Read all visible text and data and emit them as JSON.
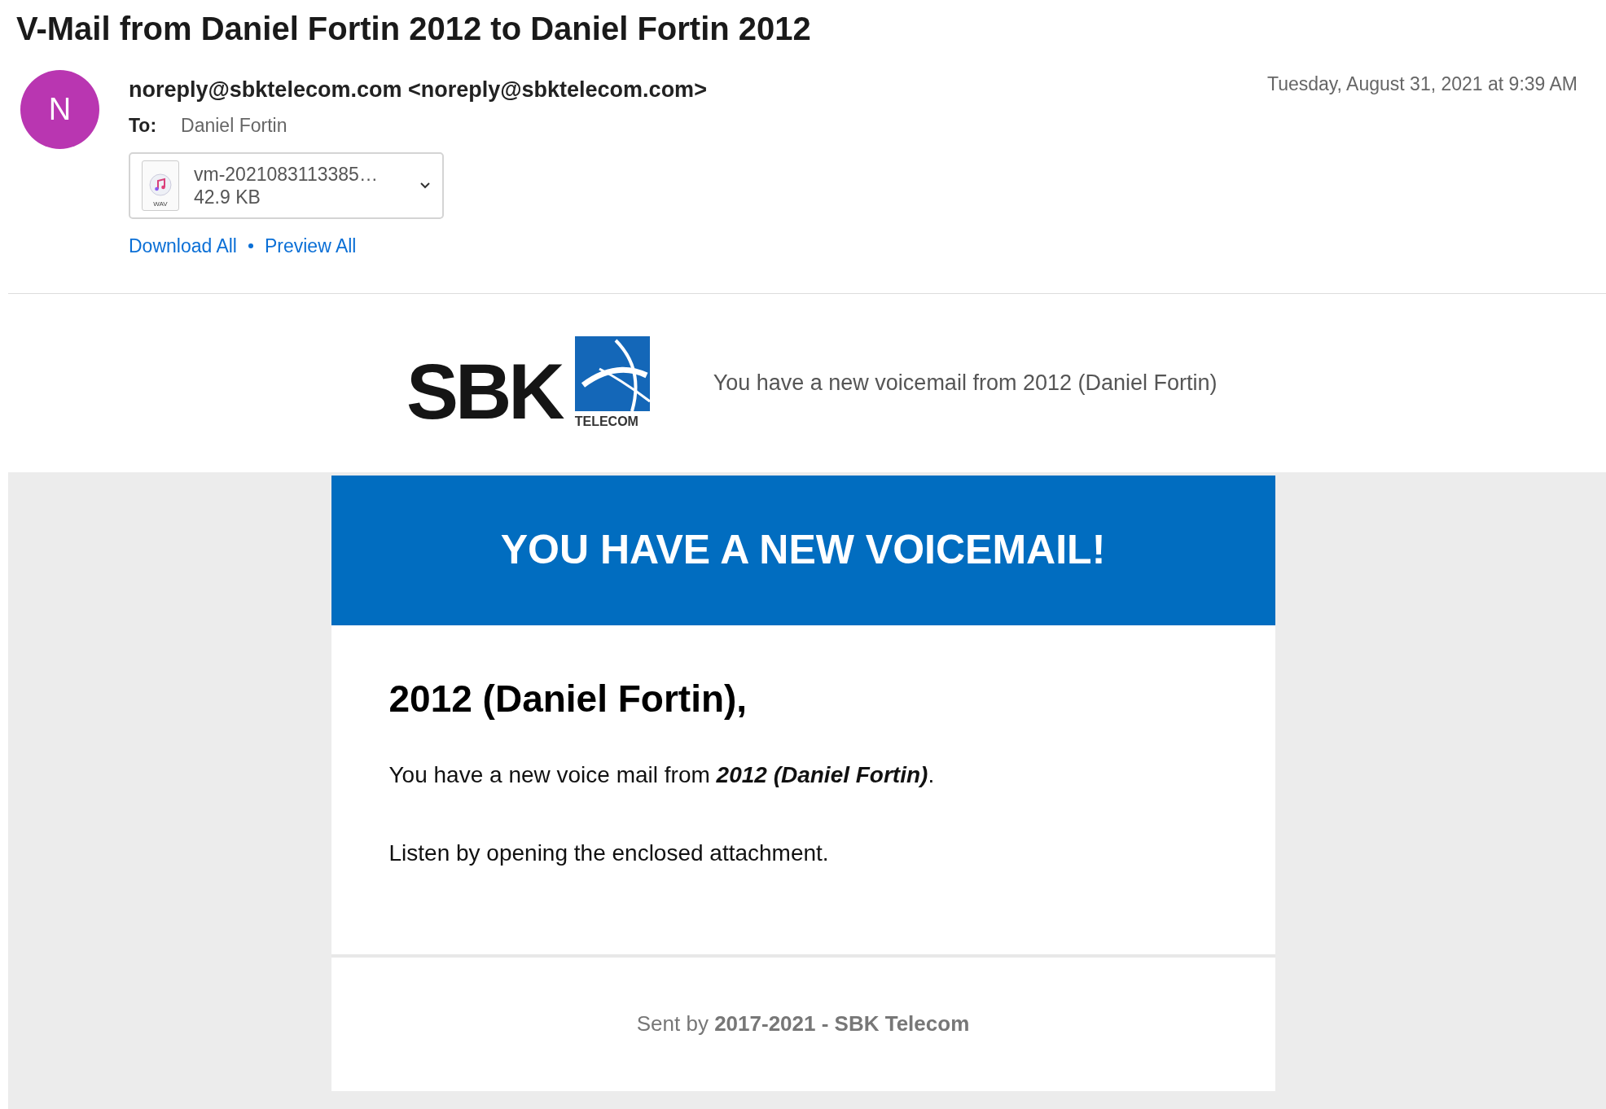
{
  "subject": "V-Mail from Daniel Fortin 2012 to Daniel Fortin 2012",
  "sender": {
    "avatar_letter": "N",
    "from": "noreply@sbktelecom.com <noreply@sbktelecom.com>",
    "to_label": "To:",
    "to": "Daniel Fortin",
    "date": "Tuesday, August 31, 2021 at 9:39 AM"
  },
  "attachment": {
    "type_label": "WAV",
    "name": "vm-2021083113385…",
    "size": "42.9 KB"
  },
  "attachment_links": [
    "Download All",
    "Preview All"
  ],
  "logo": {
    "wordmark": "SBK",
    "tagline": "TELECOM"
  },
  "preheader": "You have a new voicemail from 2012 (Daniel Fortin)",
  "banner": "YOU HAVE A NEW VOICEMAIL!",
  "greeting": "2012 (Daniel Fortin),",
  "message": {
    "text_before": "You have a new voice mail from ",
    "emphasis": "2012 (Daniel Fortin)",
    "text_after": "."
  },
  "instruction": "Listen by opening the enclosed attachment.",
  "footer": "Sent by **2017-2021 - SBK Telecom**"
}
